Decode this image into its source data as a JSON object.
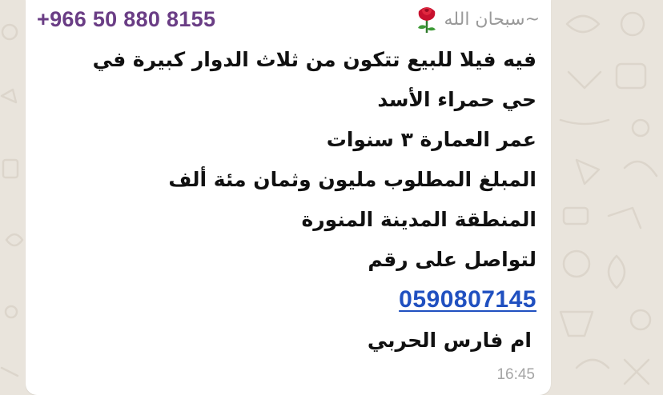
{
  "message": {
    "sender_phone": "+966 50 880 8155",
    "sender_name": "~سبحان الله",
    "sender_emoji": "rose-icon",
    "lines": [
      "فيه فيلا للبيع تتكون من ثلاث الدوار كبيرة في",
      "حي حمراء الأسد",
      "عمر العمارة ٣ سنوات",
      "المبلغ المطلوب مليون وثمان مئة ألف",
      "المنطقة المدينة المنورة",
      "لتواصل على رقم"
    ],
    "phone_link": "0590807145",
    "signature": "ام فارس الحربي",
    "time": "16:45"
  },
  "colors": {
    "phone": "#6a3d85",
    "link": "#2050c0",
    "bubble": "#ffffff",
    "wallpaper": "#e9e4dc",
    "rose": "#c8102e"
  }
}
